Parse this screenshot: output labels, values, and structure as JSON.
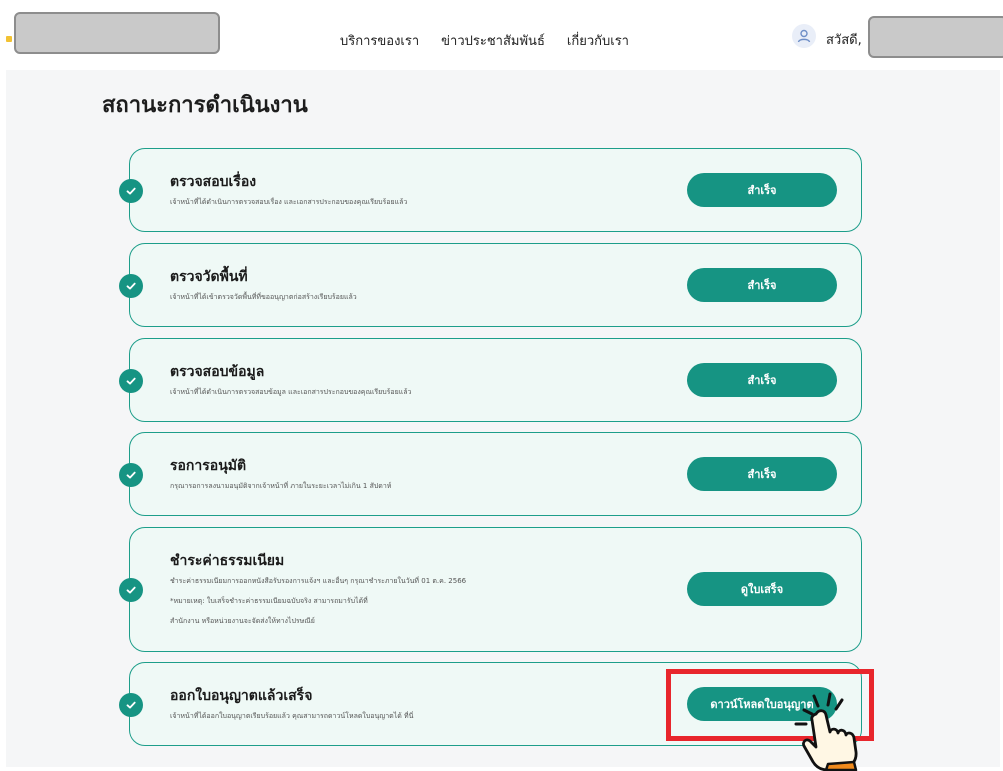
{
  "header": {
    "nav": [
      {
        "label": "บริการของเรา"
      },
      {
        "label": "ข่าวประชาสัมพันธ์"
      },
      {
        "label": "เกี่ยวกับเรา"
      }
    ],
    "greeting": "สวัสดี,"
  },
  "page": {
    "title": "สถานะการดำเนินงาน"
  },
  "steps": [
    {
      "title": "ตรวจสอบเรื่อง",
      "desc": [
        "เจ้าหน้าที่ได้ดำเนินการตรวจสอบเรื่อง และเอกสารประกอบของคุณเรียบร้อยแล้ว"
      ],
      "button": "สำเร็จ"
    },
    {
      "title": "ตรวจวัดพื้นที่",
      "desc": [
        "เจ้าหน้าที่ได้เข้าตรวจวัดพื้นที่ที่ขออนุญาตก่อสร้างเรียบร้อยแล้ว"
      ],
      "button": "สำเร็จ"
    },
    {
      "title": "ตรวจสอบข้อมูล",
      "desc": [
        "เจ้าหน้าที่ได้ดำเนินการตรวจสอบข้อมูล และเอกสารประกอบของคุณเรียบร้อยแล้ว"
      ],
      "button": "สำเร็จ"
    },
    {
      "title": "รอการอนุมัติ",
      "desc": [
        "กรุณารอการลงนามอนุมัติจากเจ้าหน้าที่ ภายในระยะเวลาไม่เกิน 1 สัปดาห์"
      ],
      "button": "สำเร็จ"
    },
    {
      "title": "ชำระค่าธรรมเนียม",
      "desc": [
        "ชำระค่าธรรมเนียมการออกหนังสือรับรองการแจ้งฯ และอื่นๆ กรุณาชำระภายในวันที่ 01 ต.ค. 2566",
        "*หมายเหตุ: ใบเสร็จชำระค่าธรรมเนียมฉบับจริง สามารถมารับได้ที่",
        "สำนักงาน หรือหน่วยงานจะจัดส่งให้ทางไปรษณีย์"
      ],
      "button": "ดูใบเสร็จ"
    },
    {
      "title": "ออกใบอนุญาตแล้วเสร็จ",
      "desc": [
        "เจ้าหน้าที่ได้ออกใบอนุญาตเรียบร้อยแล้ว คุณสามารถดาวน์โหลดใบอนุญาตได้ ที่นี่"
      ],
      "button": "ดาวน์โหลดใบอนุญาต"
    }
  ],
  "colors": {
    "accent": "#169483",
    "card_bg": "#eff9f6",
    "highlight": "#e8262c"
  }
}
